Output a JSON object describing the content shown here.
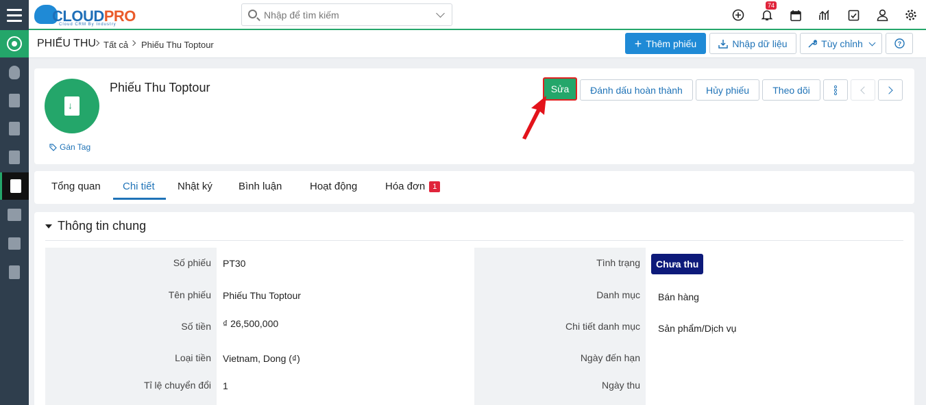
{
  "app": {
    "logo_main": "CLOUD",
    "logo_accent": "PRO",
    "logo_tagline": "Cloud CRM By Industry"
  },
  "search": {
    "placeholder": "Nhập để tìm kiếm"
  },
  "notifications": {
    "count": "74"
  },
  "breadcrumb": {
    "module": "PHIẾU THU",
    "level1": "Tất cả",
    "current": "Phiếu Thu Toptour"
  },
  "toolbar": {
    "add_label": "Thêm phiếu",
    "import_label": "Nhập dữ liệu",
    "customize_label": "Tùy chỉnh"
  },
  "record": {
    "title": "Phiếu Thu Toptour",
    "tag_label": "Gán Tag",
    "actions": {
      "edit": "Sửa",
      "mark_done": "Đánh dấu hoàn thành",
      "cancel": "Hủy phiếu",
      "follow": "Theo dõi"
    }
  },
  "tabs": [
    {
      "label": "Tổng quan"
    },
    {
      "label": "Chi tiết"
    },
    {
      "label": "Nhật ký"
    },
    {
      "label": "Bình luận"
    },
    {
      "label": "Hoạt động"
    },
    {
      "label": "Hóa đơn",
      "count": "1"
    }
  ],
  "section": {
    "title": "Thông tin chung",
    "left": [
      {
        "label": "Số phiếu",
        "value": "PT30"
      },
      {
        "label": "Tên phiếu",
        "value": "Phiếu Thu Toptour"
      },
      {
        "label": "Số tiền",
        "value": "₫ 26,500,000"
      },
      {
        "label": "Loại tiền",
        "value": "Vietnam, Dong (₫)"
      },
      {
        "label": "Tỉ lệ chuyển đổi",
        "value": "1"
      }
    ],
    "right": [
      {
        "label": "Tình trạng",
        "value": "Chưa thu"
      },
      {
        "label": "Danh mục",
        "value": "Bán hàng"
      },
      {
        "label": "Chi tiết danh mục",
        "value": "Sản phẩm/Dịch vụ"
      },
      {
        "label": "Ngày đến hạn",
        "value": ""
      },
      {
        "label": "Ngày thu",
        "value": ""
      }
    ]
  },
  "colors": {
    "brand_green": "#24a66a",
    "brand_blue": "#1f8ad6",
    "status_navy": "#0d1a7a",
    "badge_red": "#e0243b"
  }
}
